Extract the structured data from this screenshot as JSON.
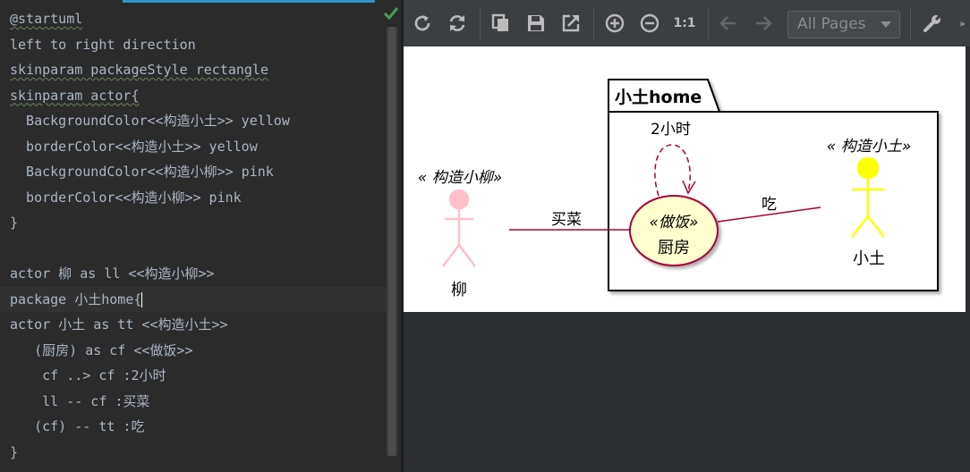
{
  "editor": {
    "lines": [
      "@startuml",
      "left to right direction",
      "skinparam packageStyle rectangle",
      "skinparam actor{",
      "  BackgroundColor<<构造小土>> yellow",
      "  borderColor<<构造小土>> yellow",
      "  BackgroundColor<<构造小柳>> pink",
      "  borderColor<<构造小柳>> pink",
      "}",
      "",
      "actor 柳 as ll <<构造小柳>>",
      "package 小土home{",
      "actor 小土 as tt <<构造小土>>",
      "   (厨房) as cf <<做饭>>",
      "    cf ..> cf :2小时",
      "    ll -- cf :买菜",
      "   (cf) -- tt :吃",
      "}"
    ]
  },
  "toolbar": {
    "page_select_value": "All Pages",
    "zoom_actual_label": "1:1"
  },
  "diagram": {
    "package_title": "小土home",
    "actor_left": {
      "stereotype": "« 构造小柳»",
      "name": "柳",
      "color": "#ffc0cb"
    },
    "actor_right": {
      "stereotype": "« 构造小土»",
      "name": "小土",
      "color": "#ffff00"
    },
    "usecase": {
      "stereotype": "«做饭»",
      "name": "厨房",
      "fill": "#fefece",
      "border": "#a80036"
    },
    "self_label": "2小时",
    "label_buy": "买菜",
    "label_eat": "吃"
  }
}
